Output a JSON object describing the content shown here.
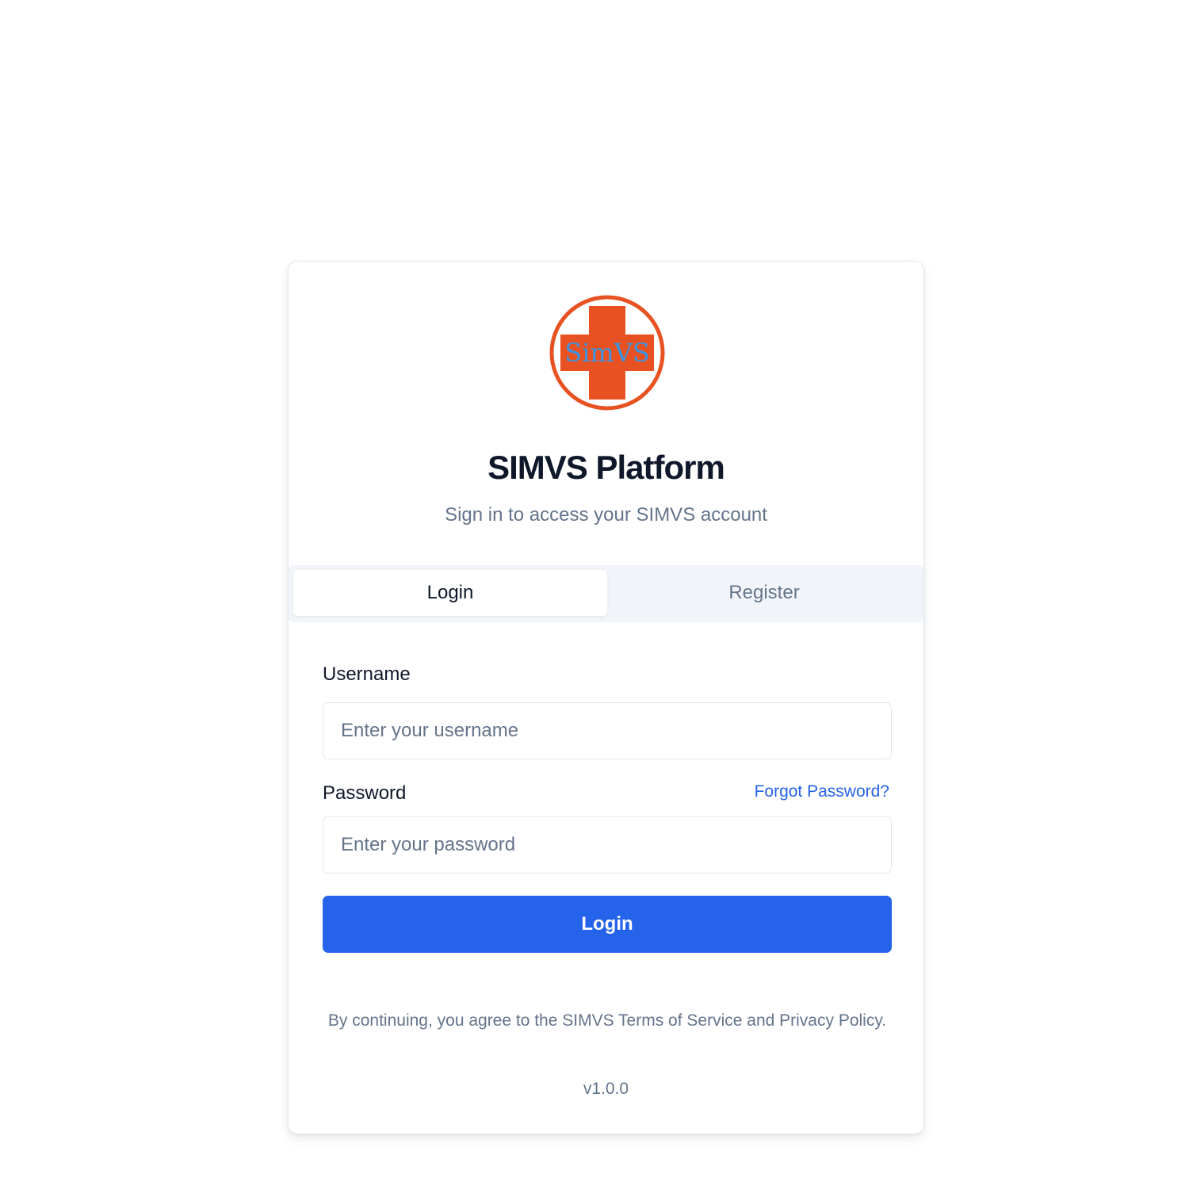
{
  "brand": {
    "logo_text": "SimVS",
    "logo_colors": {
      "red": "#e85222",
      "text_blue": "#3b95e3"
    },
    "title": "SIMVS Platform",
    "subtitle": "Sign in to access your SIMVS account"
  },
  "tabs": [
    {
      "label": "Login",
      "active": true
    },
    {
      "label": "Register",
      "active": false
    }
  ],
  "form": {
    "username_label": "Username",
    "username_placeholder": "Enter your username",
    "username_value": "",
    "password_label": "Password",
    "password_placeholder": "Enter your password",
    "password_value": "",
    "forgot_label": "Forgot Password?",
    "submit_label": "Login"
  },
  "footer": {
    "terms": "By continuing, you agree to the SIMVS Terms of Service and Privacy Policy.",
    "version": "v1.0.0"
  },
  "colors": {
    "primary": "#2563eb",
    "muted_text": "#64748b",
    "tab_background": "#f1f5f9"
  }
}
